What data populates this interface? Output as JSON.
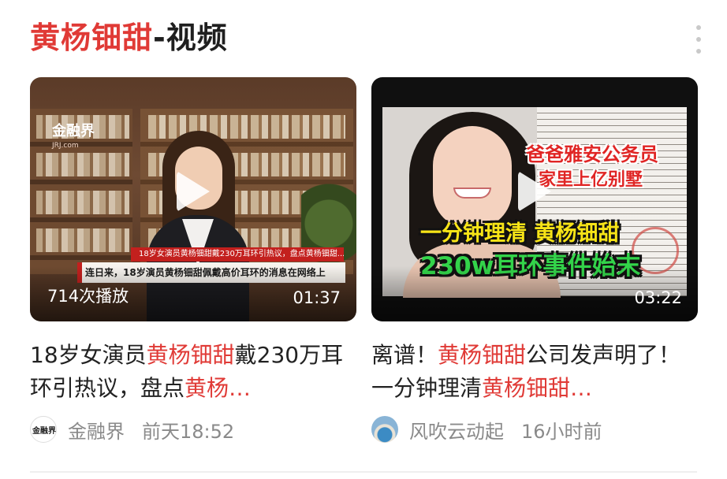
{
  "header": {
    "title_highlight": "黄杨钿甜",
    "title_rest": "-视频"
  },
  "colors": {
    "accent": "#e03a36",
    "text": "#222222",
    "muted": "#8a8a8a"
  },
  "cards": [
    {
      "thumbnail": {
        "logo": "金融界",
        "logo_sub": "JRJ.com",
        "banner_top": "18岁女演员黄杨钿甜戴230万耳环引热议，盘点黄杨钿甜...",
        "banner_bottom": "连日来，18岁演员黄杨钿甜佩戴高价耳环的消息在网络上"
      },
      "views": "714次播放",
      "duration": "01:37",
      "title_parts": [
        "18岁女演员",
        "黄杨钿甜",
        "戴230万耳环引热议，盘点",
        "黄杨…"
      ],
      "author": "金融界",
      "author_avatar_text": "金融界",
      "time": "前天18:52"
    },
    {
      "thumbnail": {
        "caption_red_1": "爸爸雅安公务员",
        "caption_red_2": "家里上亿别墅",
        "caption_yellow": "一分钟理清 黄杨钿甜",
        "caption_green": "230w耳环事件始末"
      },
      "views": "",
      "duration": "03:22",
      "title_parts": [
        "离谱！",
        "黄杨钿甜",
        "公司发声明了！一分钟理清",
        "黄杨钿甜…"
      ],
      "author": "风吹云动起",
      "time": "16小时前"
    }
  ]
}
